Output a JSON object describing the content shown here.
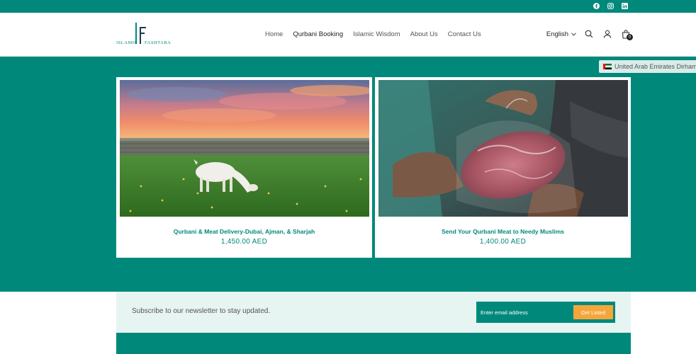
{
  "brand": {
    "logo_left": "ISLAMIC",
    "logo_right": "FASHTARA",
    "primary_color": "#00897b",
    "accent_color": "#f4a63b"
  },
  "topbar": {
    "social_icons": [
      "facebook-icon",
      "instagram-icon",
      "linkedin-icon"
    ]
  },
  "nav": {
    "items": [
      {
        "label": "Home"
      },
      {
        "label": "Qurbani Booking"
      },
      {
        "label": "Islamic Wisdom"
      },
      {
        "label": "About Us"
      },
      {
        "label": "Contact Us"
      }
    ]
  },
  "header": {
    "language": "English",
    "cart_count": "0"
  },
  "currency": {
    "label": "United Arab Emirates Dirham"
  },
  "products": [
    {
      "title": "Qurbani & Meat Delivery-Dubai, Ajman, & Sharjah",
      "price": "1,450.00 AED"
    },
    {
      "title": "Send Your Qurbani Meat to Needy Muslims",
      "price": "1,400.00 AED"
    }
  ],
  "newsletter": {
    "text": "Subscribe to our newsletter to stay updated.",
    "placeholder": "Enter email address",
    "button": "Get Listed"
  }
}
